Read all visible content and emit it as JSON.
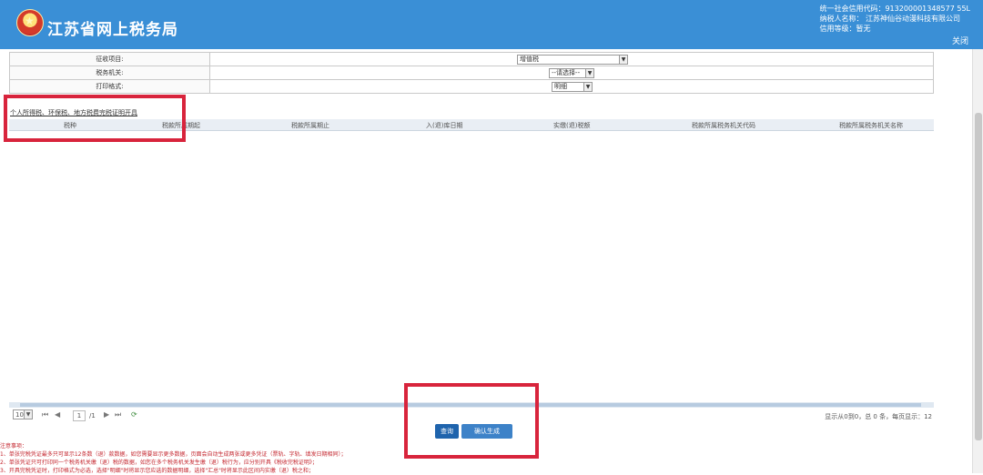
{
  "header": {
    "title": "江苏省网上税务局",
    "credit_code": "统一社会信用代码：913200001348577 55L",
    "taxpayer_name": "纳税人名称： 江苏神仙谷动漫科技有限公司",
    "credit_level": "信用等级：暂无",
    "close_label": "关闭"
  },
  "form": {
    "rows": [
      {
        "label": "征收项目:",
        "value": "增值税"
      },
      {
        "label": "税务机关:",
        "value": "--请选择--"
      },
      {
        "label": "打印格式:",
        "value": "明细"
      }
    ]
  },
  "section_link": "个人所得税、环保税、地方税费完税证明开具",
  "table": {
    "columns": [
      "税种",
      "税款所属期起",
      "税款所属期止",
      "入(退)库日期",
      "实缴(退)税额",
      "税款所属税务机关代码",
      "税款所属税务机关名称"
    ]
  },
  "pager": {
    "page_size": "10",
    "current_page": "1",
    "total_pages": "/1",
    "info": "显示从0到0，总 0 条，每页显示：12"
  },
  "buttons": {
    "query": "查询",
    "confirm": "确认生成"
  },
  "notes": {
    "title": "注意事项：",
    "items": [
      "1、单张完税凭证最多只可显示12条数（退）款数据，如您需要显示更多数据，页面会自动生成两张或更多凭证（票轨、字轨、填发日期相同）；",
      "2、单张凭证只可打印同一个税务机关缴（退）税的数据，如您在多个税务机关发生缴（退）税行为，应分别开具《税收完税证明》；",
      "3、开具完税凭证时，打印格式为必选，选择\"明细\"时将显示您应选的数据明细，选择\"汇总\"时将显示此区间内实缴（退）税之和；"
    ]
  },
  "colors": {
    "header_bg": "#3a8fd6",
    "annotation_red": "#d8243c",
    "primary_button": "#1f64ad"
  }
}
